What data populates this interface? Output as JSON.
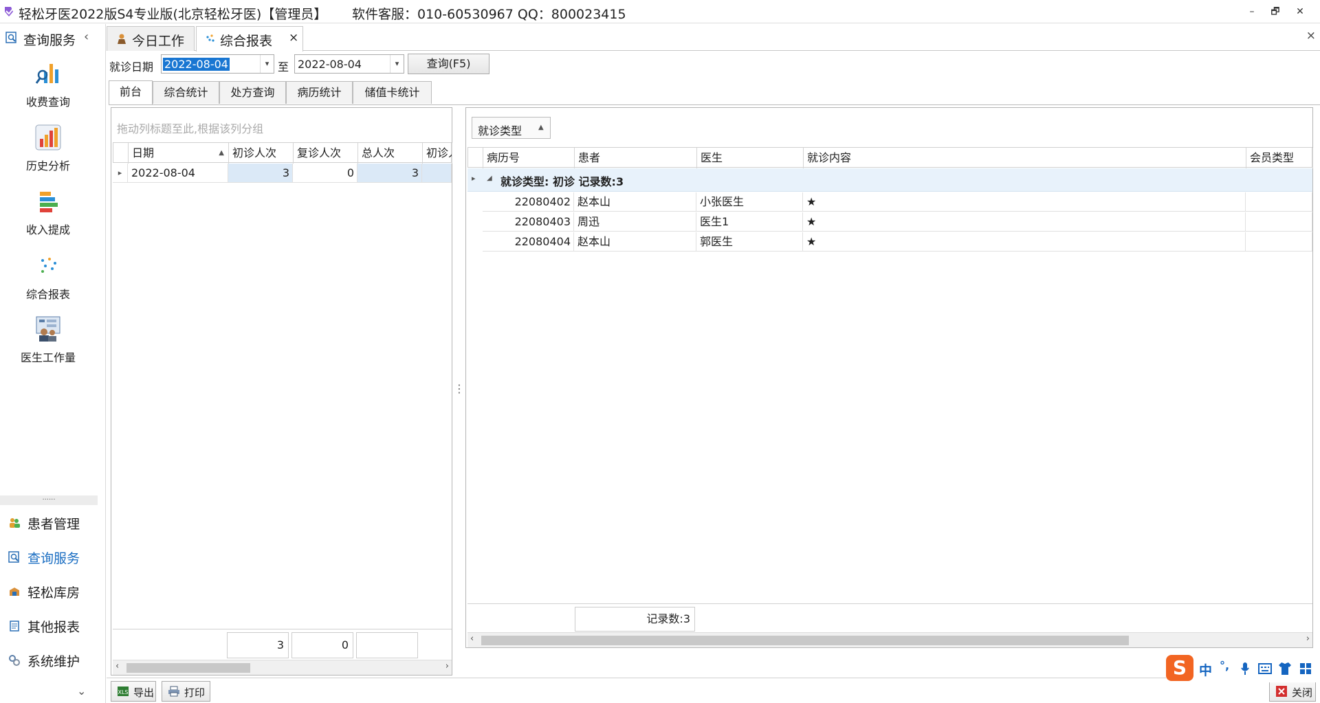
{
  "window": {
    "title": "轻松牙医2022版S4专业版(北京轻松牙医)【管理员】",
    "support": "软件客服：010-60530967 QQ：800023415",
    "minimize": "–",
    "restore": "🗗",
    "close": "✕"
  },
  "leftnav": {
    "header": "查询服务",
    "collapse_glyph": "‹",
    "items": [
      {
        "label": "收费查询",
        "icon": "search-chart-icon"
      },
      {
        "label": "历史分析",
        "icon": "bar-chart-icon"
      },
      {
        "label": "收入提成",
        "icon": "stacked-bars-icon"
      },
      {
        "label": "综合报表",
        "icon": "dots-icon"
      },
      {
        "label": "医生工作量",
        "icon": "doctor-board-icon"
      }
    ],
    "splitter_dots": "......",
    "groups": [
      {
        "label": "患者管理",
        "icon": "patients-icon"
      },
      {
        "label": "查询服务",
        "icon": "search-icon"
      },
      {
        "label": "轻松库房",
        "icon": "warehouse-icon"
      },
      {
        "label": "其他报表",
        "icon": "report-icon"
      },
      {
        "label": "系统维护",
        "icon": "gears-icon"
      }
    ],
    "bottom_chevron": "⌄"
  },
  "doctabs": [
    {
      "label": "今日工作",
      "icon": "worker-icon"
    },
    {
      "label": "综合报表",
      "icon": "dots-icon",
      "close": "×"
    }
  ],
  "close_all": "×",
  "filter": {
    "date_label": "就诊日期",
    "from": "2022-08-04",
    "to_label": "至",
    "to": "2022-08-04",
    "query_button": "查询(F5)",
    "arrow": "▾"
  },
  "subtabs": [
    "前台",
    "综合统计",
    "处方查询",
    "病历统计",
    "储值卡统计"
  ],
  "left_grid": {
    "group_hint": "拖动列标题至此,根据该列分组",
    "columns": [
      "日期",
      "初诊人次",
      "复诊人次",
      "总人次",
      "初诊人"
    ],
    "sort_glyph": "▲",
    "row_indicator": "▸",
    "rows": [
      {
        "date": "2022-08-04",
        "first": "3",
        "revisit": "0",
        "total": "3",
        "extra": ""
      }
    ],
    "footer": [
      "3",
      "0",
      ""
    ]
  },
  "right_grid": {
    "group_chip": "就诊类型",
    "chip_glyph": "▲",
    "columns": [
      "病历号",
      "患者",
      "医生",
      "就诊内容",
      "会员类型"
    ],
    "group_row": "就诊类型: 初诊 记录数:3",
    "expand_glyph": "◢",
    "row_indicator": "▸",
    "rows": [
      {
        "id": "22080402",
        "patient": "赵本山",
        "doctor": "小张医生",
        "content": "★",
        "member": ""
      },
      {
        "id": "22080403",
        "patient": "周迅",
        "doctor": "医生1",
        "content": "★",
        "member": ""
      },
      {
        "id": "22080404",
        "patient": "赵本山",
        "doctor": "郭医生",
        "content": "★",
        "member": ""
      }
    ],
    "footer": "记录数:3"
  },
  "splitter_glyph": "⋮",
  "scroll": {
    "left": "‹",
    "right": "›"
  },
  "bottom": {
    "export": "导出",
    "print": "打印",
    "close": "关闭"
  },
  "ime": {
    "logo": "S",
    "mode": "中",
    "punct": "°,"
  },
  "colors": {
    "accent": "#1b6ec2",
    "selection": "#1976d2",
    "group_row_bg": "#e8f2fb",
    "selected_cell_bg": "#dbe9f7"
  }
}
